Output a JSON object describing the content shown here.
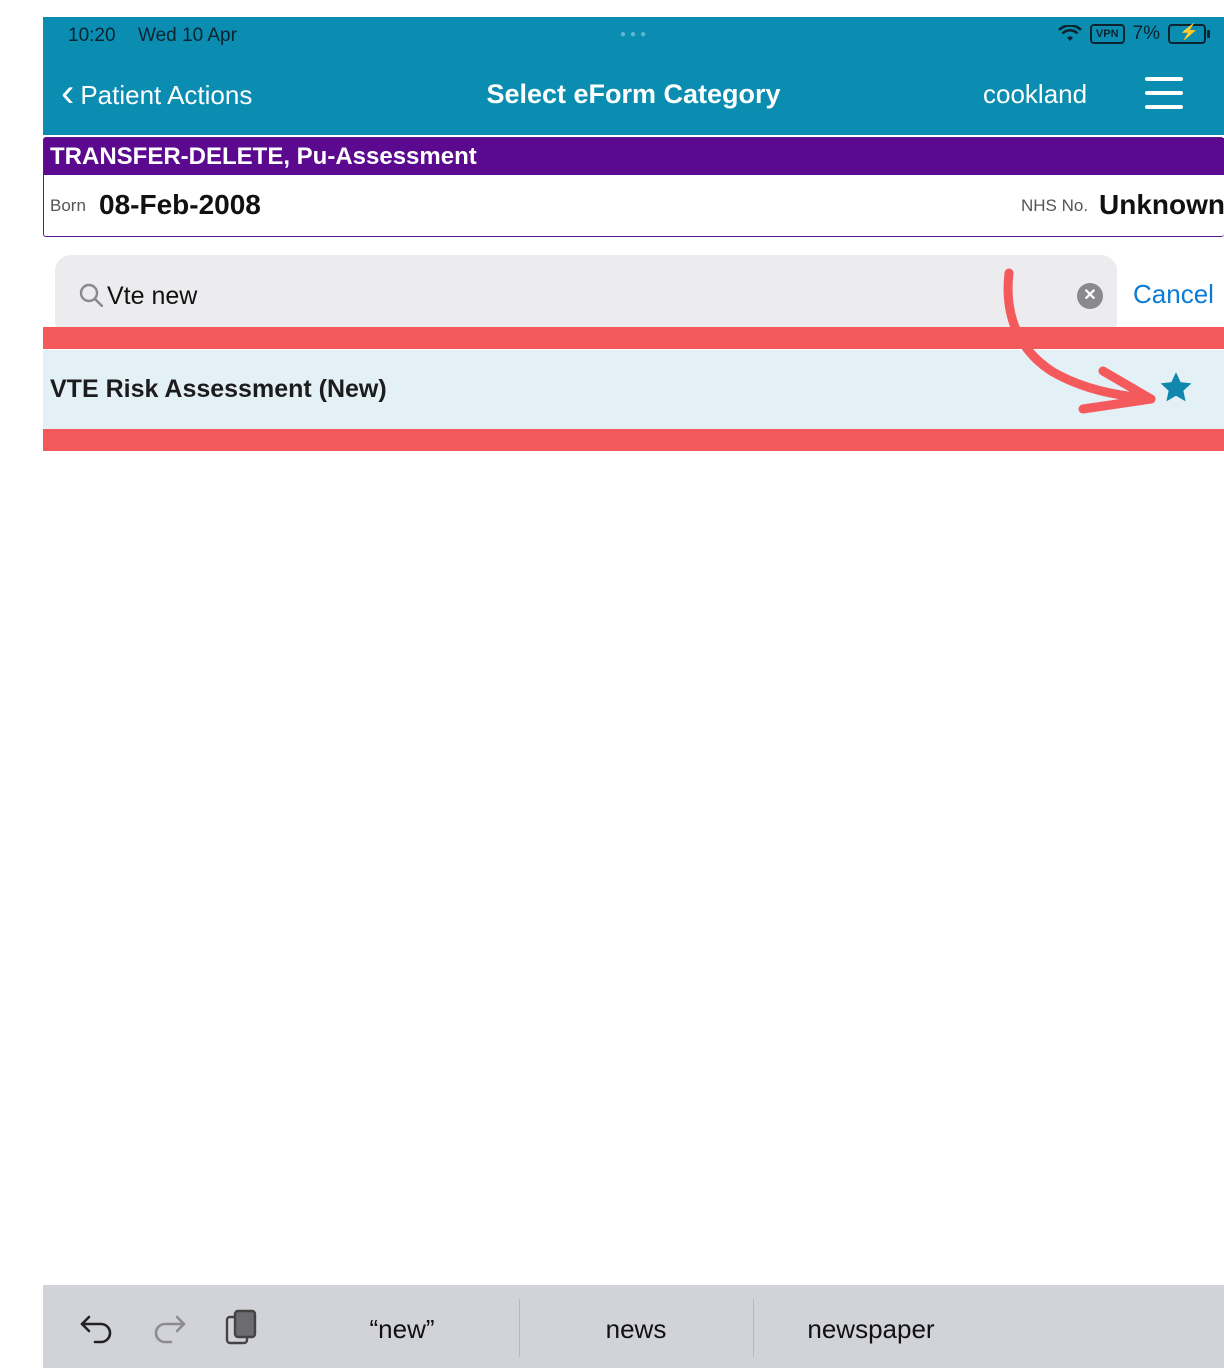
{
  "status_bar": {
    "time": "10:20",
    "date": "Wed 10 Apr",
    "vpn": "VPN",
    "battery": "7%"
  },
  "nav": {
    "back_label": "Patient Actions",
    "title": "Select eForm Category",
    "user": "cookland"
  },
  "patient": {
    "name": "TRANSFER-DELETE, Pu-Assessment",
    "born_label": "Born",
    "born_value": "08-Feb-2008",
    "nhs_label": "NHS No.",
    "nhs_value": "Unknown"
  },
  "search": {
    "value": "Vte new",
    "cancel_label": "Cancel"
  },
  "results": [
    {
      "label": "VTE Risk Assessment (New)",
      "favourite": true
    }
  ],
  "keyboard": {
    "suggestions": [
      "“new”",
      "news",
      "newspaper"
    ]
  },
  "colors": {
    "nav_bar": "#0a8db1",
    "patient_bar": "#5b0a8f",
    "highlight": "#f45a5c",
    "star": "#1287ad",
    "link": "#0a7bd6"
  },
  "icons": [
    "back-chevron-icon",
    "menu-icon",
    "wifi-icon",
    "battery-icon",
    "search-icon",
    "clear-icon",
    "star-icon",
    "undo-icon",
    "redo-icon",
    "clipboard-icon"
  ]
}
